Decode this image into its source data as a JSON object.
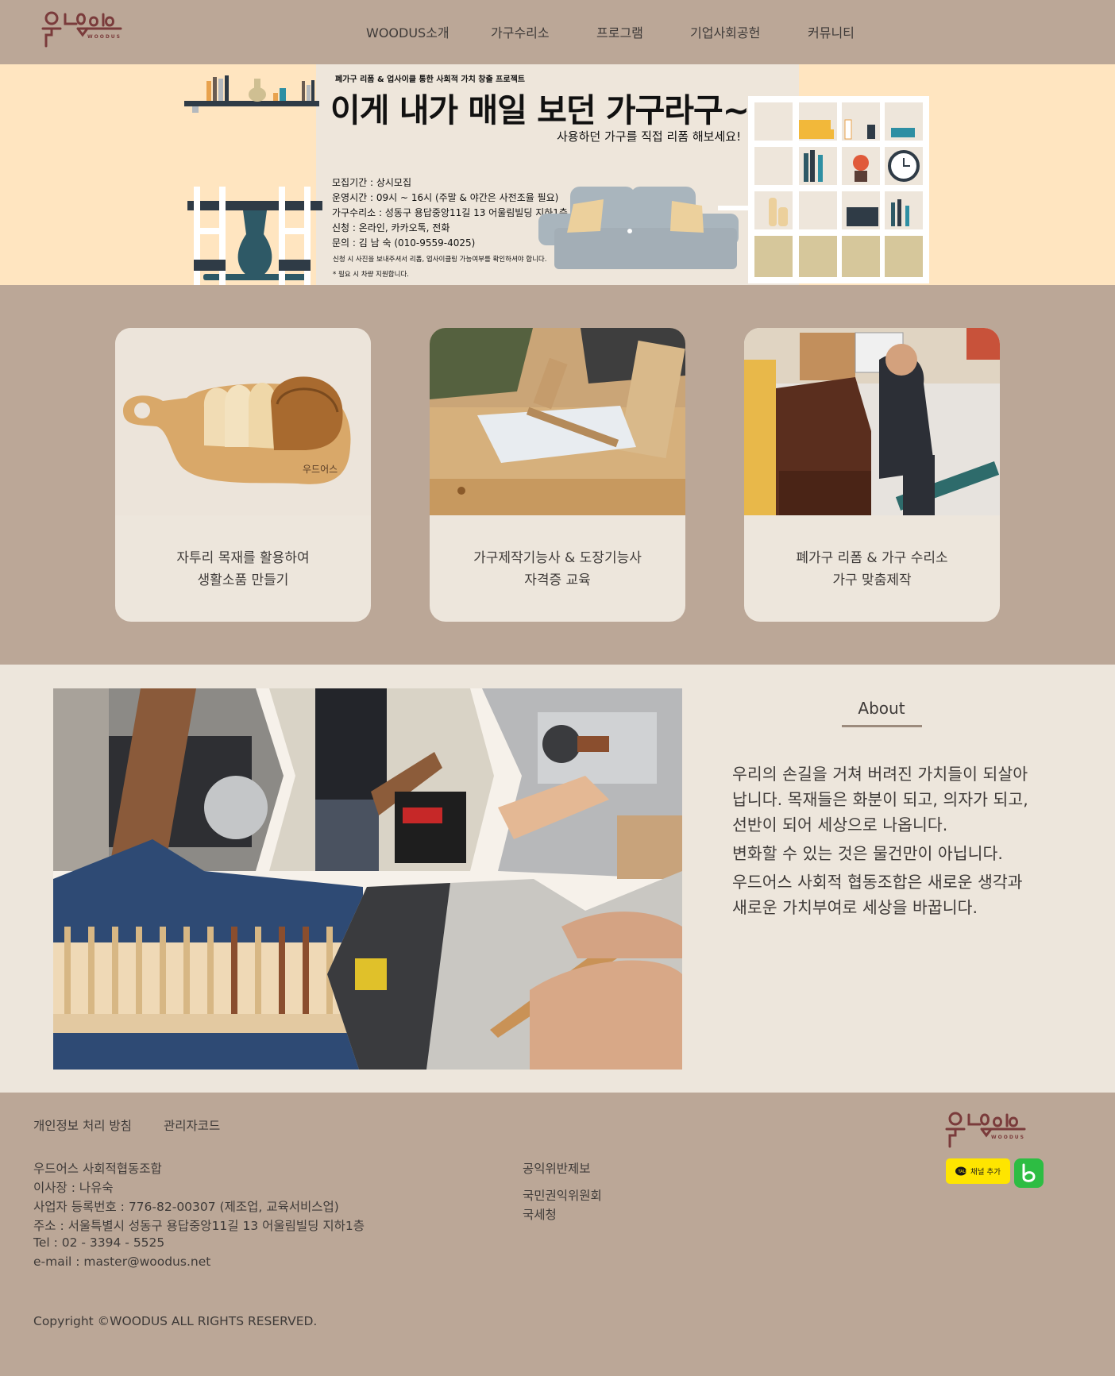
{
  "brand": {
    "logo_text": "우드어스",
    "logo_sub": "WOODUS"
  },
  "nav": [
    {
      "label": "WOODUS소개"
    },
    {
      "label": "가구수리소"
    },
    {
      "label": "프로그램"
    },
    {
      "label": "기업사회공헌"
    },
    {
      "label": "커뮤니티"
    }
  ],
  "banner": {
    "subtitle": "폐가구 리폼 & 업사이클 통한 사회적 가치 창출 프로젝트",
    "headline": "이게 내가 매일 보던 가구라구~?",
    "tagline": "사용하던 가구를 직접 리폼 해보세요!",
    "info": [
      "모집기간 : 상시모집",
      "운영시간 : 09시 ~ 16시 (주말 & 야간은 사전조율 필요)",
      "가구수리소 : 성동구 용답중앙11길 13 어울림빌딩 지하1층",
      "신청 : 온라인, 카카오톡, 전화",
      "문의 : 김 남 숙 (010-9559-4025)"
    ],
    "notes": [
      "신청 시 사진을 보내주셔서 리폼, 업사이클링 가능여부를 확인하셔야 합니다.",
      "* 필요 시 차량 지원합니다."
    ]
  },
  "cards": [
    {
      "line1": "자투리 목재를 활용하여",
      "line2": "생활소품 만들기"
    },
    {
      "line1": "가구제작기능사 & 도장기능사",
      "line2": "자격증 교육"
    },
    {
      "line1": "폐가구 리폼 & 가구 수리소",
      "line2": "가구 맞춤제작"
    }
  ],
  "about": {
    "title": "About",
    "lines": [
      "우리의 손길을 거쳐 버려진 가치들이 되살아",
      "납니다. 목재들은 화분이 되고, 의자가 되고,",
      "선반이 되어 세상으로 나옵니다.",
      "변화할 수 있는 것은 물건만이 아닙니다.",
      "우드어스 사회적 협동조합은 새로운 생각과",
      "새로운 가치부여로 세상을 바꿉니다."
    ]
  },
  "footer": {
    "privacy": "개인정보 처리 방침",
    "admin": "관리자코드",
    "info": [
      "우드어스 사회적협동조합",
      "이사장 : 나유숙",
      "사업자 등록번호 : 776-82-00307 (제조업, 교육서비스업)",
      "주소 : 서울특별시 성동구 용답중앙11길 13 어울림빌딩 지하1층",
      "Tel : 02 - 3394 - 5525",
      "e-mail : master@woodus.net"
    ],
    "report_title": "공익위반제보",
    "report_links": [
      "국민권익위원회",
      "국세청"
    ],
    "kakao_label": "채널 추가",
    "copyright": "Copyright ©WOODUS ALL RIGHTS RESERVED."
  },
  "colors": {
    "header_bg": "#bba797",
    "banner_bg": "#ffe5c0",
    "panel_bg": "#ede6dc",
    "text": "#3e3a38",
    "kakao": "#fee500",
    "blog": "#2dbd43"
  }
}
